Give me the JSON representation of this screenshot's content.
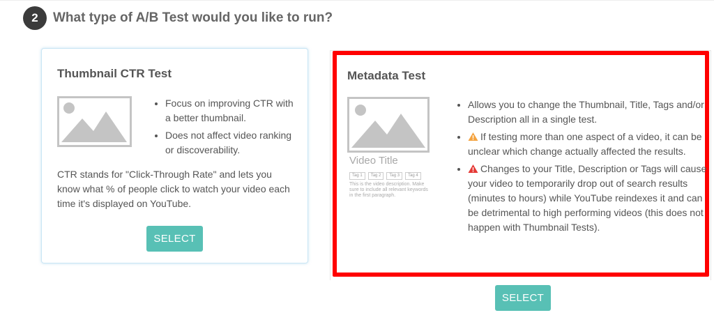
{
  "step": {
    "number": "2",
    "title": "What type of A/B Test would you like to run?"
  },
  "thumbnail_card": {
    "title": "Thumbnail CTR Test",
    "bullets": [
      "Focus on improving CTR with a better thumbnail.",
      "Does not affect video ranking or discoverability."
    ],
    "description": "CTR stands for \"Click-Through Rate\" and lets you know what % of people click to watch your video each time it's displayed on YouTube.",
    "button": "SELECT"
  },
  "metadata_card": {
    "title": "Metadata Test",
    "bullets": [
      "Allows you to change the Thumbnail, Title, Tags and/or Description all in a single test.",
      "If testing more than one aspect of a video, it can be unclear which change actually affected the results.",
      "Changes to your Title, Description or Tags will cause your video to temporarily drop out of search results (minutes to hours) while YouTube reindexes it and can be detrimental to high performing videos (this does not happen with Thumbnail Tests)."
    ],
    "preview": {
      "video_title": "Video Title",
      "tags": [
        "Tag 1",
        "Tag 2",
        "Tag 3",
        "Tag 4"
      ],
      "description": "This is the video description. Make sure to include all relevant keywords in the first paragraph."
    },
    "button": "SELECT",
    "warning_icons": [
      "warning-orange-icon",
      "warning-red-icon"
    ]
  },
  "colors": {
    "accent_button": "#58c0b5",
    "selected_border": "#ff0000",
    "card_border": "#c9e6f5",
    "badge": "#3b3b3b"
  }
}
